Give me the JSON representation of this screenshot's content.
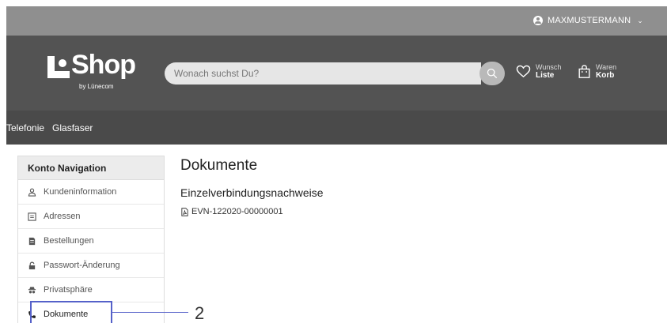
{
  "topbar": {
    "user_label": "MAXMUSTERMANN",
    "chevron": "⌄"
  },
  "header": {
    "logo_title": "Shop",
    "logo_subtitle": "by Lünecom",
    "search_placeholder": "Wonach suchst Du?",
    "wishlist": {
      "small": "Wunsch",
      "big": "Liste",
      "icon": "heart-icon"
    },
    "cart": {
      "small": "Waren",
      "big": "Korb",
      "icon": "shopping-bag-icon"
    }
  },
  "nav": {
    "items": [
      "Telefonie",
      "Glasfaser"
    ]
  },
  "sidebar": {
    "title": "Konto Navigation",
    "items": [
      {
        "label": "Kundeninformation",
        "icon": "user-icon"
      },
      {
        "label": "Adressen",
        "icon": "address-card-icon"
      },
      {
        "label": "Bestellungen",
        "icon": "document-icon"
      },
      {
        "label": "Passwort-Änderung",
        "icon": "lock-icon"
      },
      {
        "label": "Privatsphäre",
        "icon": "privacy-icon"
      },
      {
        "label": "Dokumente",
        "icon": "phone-icon"
      }
    ]
  },
  "main": {
    "title": "Dokumente",
    "section_title": "Einzelverbindungsnachweise",
    "documents": [
      {
        "label": "EVN-122020-00000001",
        "icon": "pdf-icon"
      }
    ]
  },
  "annotation": {
    "number": "2",
    "color": "#5561c9"
  }
}
